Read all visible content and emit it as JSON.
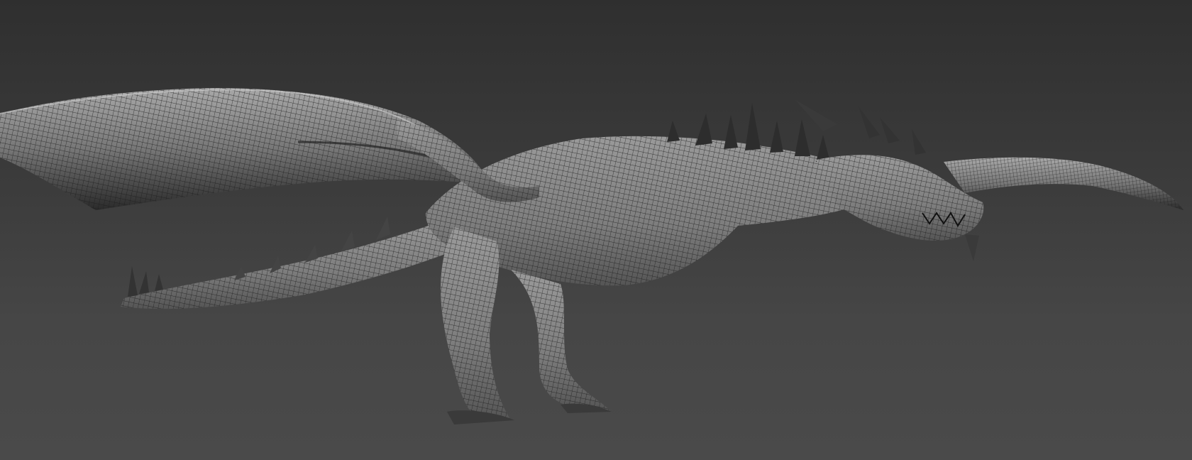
{
  "viewport": {
    "background_top": "#2f2f2f",
    "background_bottom": "#4a4a4a",
    "model_type": "dragon-wireframe-mesh",
    "mesh_color": "#8c8c8c",
    "wire_color": "#1e1e1e"
  }
}
